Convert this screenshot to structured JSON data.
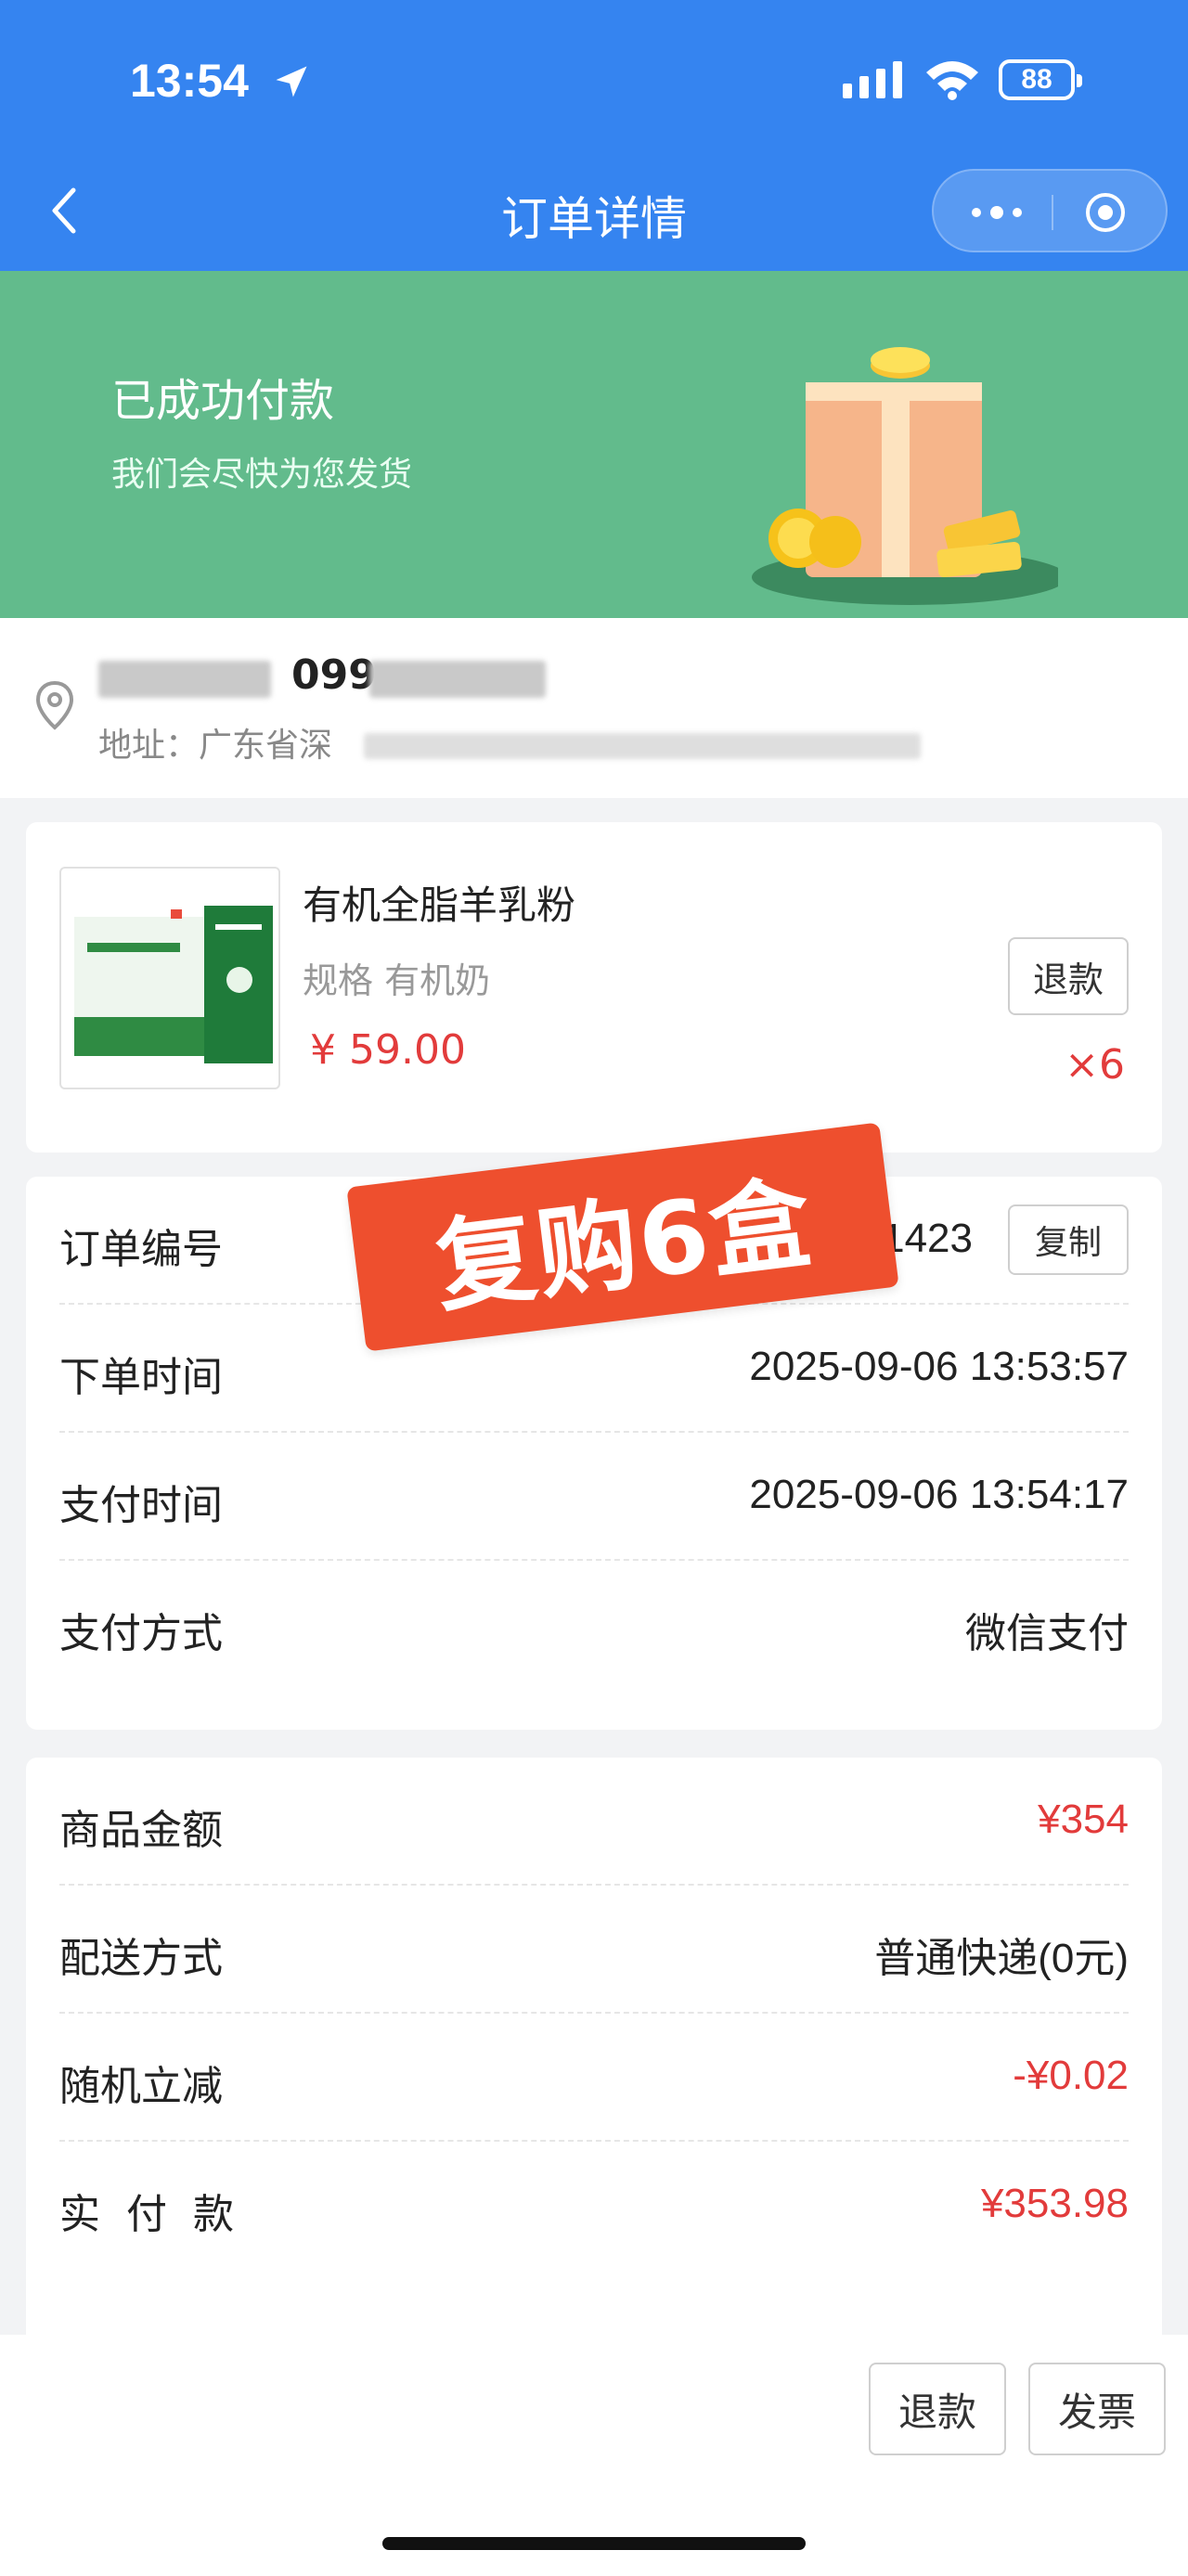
{
  "status_bar": {
    "time": "13:54",
    "battery": "88"
  },
  "nav": {
    "title": "订单详情"
  },
  "banner": {
    "title": "已成功付款",
    "subtitle": "我们会尽快为您发货"
  },
  "address": {
    "name_visible": "099",
    "address_prefix": "地址：广东省深"
  },
  "product": {
    "name": "有机全脂羊乳粉",
    "spec": "规格 有机奶",
    "price": "¥ 59.00",
    "quantity": "×6",
    "refund_label": "退款"
  },
  "stamp_text": "复购6盒",
  "order_info": {
    "rows": [
      {
        "label": "订单编号",
        "value": "61423"
      },
      {
        "label": "下单时间",
        "value": "2025-09-06 13:53:57"
      },
      {
        "label": "支付时间",
        "value": "2025-09-06 13:54:17"
      },
      {
        "label": "支付方式",
        "value": "微信支付"
      }
    ],
    "copy_label": "复制"
  },
  "amounts": {
    "rows": [
      {
        "label": "商品金额",
        "value": "¥354"
      },
      {
        "label": "配送方式",
        "value": "普通快递(0元)"
      },
      {
        "label": "随机立减",
        "value": "-¥0.02"
      },
      {
        "label": "实付款",
        "value": "¥353.98"
      }
    ]
  },
  "bottom_bar": {
    "refund_label": "退款",
    "invoice_label": "发票"
  },
  "colors": {
    "primary": "#3584f0",
    "banner": "#62bb8c",
    "price": "#e23b3b",
    "stamp": "#ee4f2e"
  }
}
